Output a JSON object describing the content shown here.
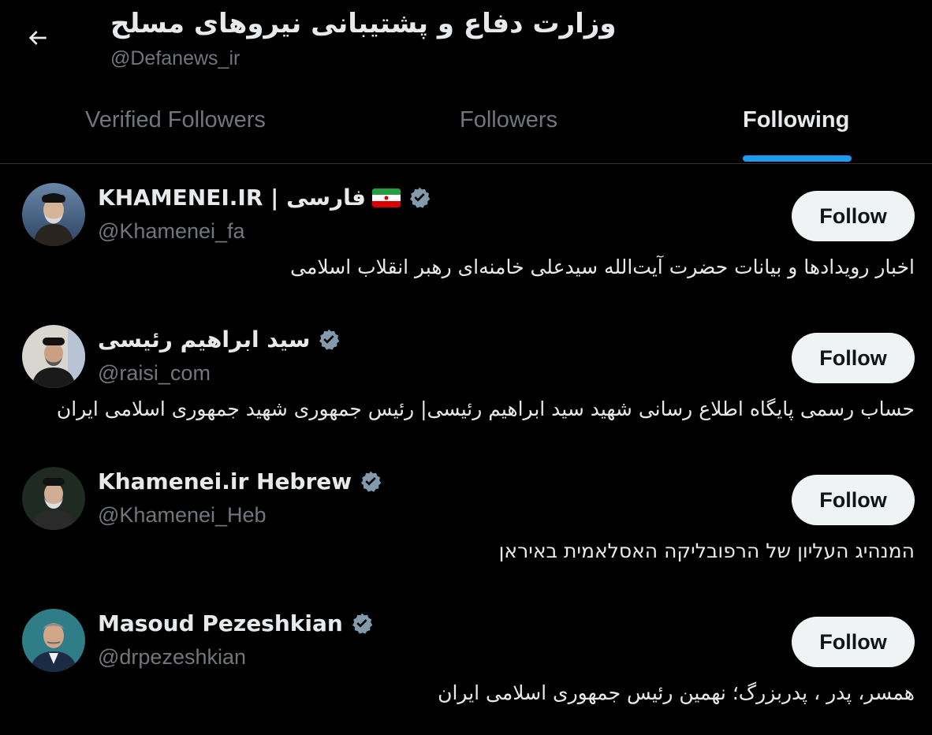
{
  "header": {
    "title": "وزارت دفاع و پشتیبانی نیروهای مسلح",
    "handle": "@Defanews_ir",
    "back_icon": "arrow-left-icon"
  },
  "tabs": [
    {
      "label": "Verified Followers",
      "active": false
    },
    {
      "label": "Followers",
      "active": false
    },
    {
      "label": "Following",
      "active": true
    }
  ],
  "accent_color": "#1d9bf0",
  "users": [
    {
      "name": "KHAMENEI.IR | فارسی",
      "has_flag": true,
      "flag_icon": "iran-flag-icon",
      "verified_icon": "verified-badge-icon",
      "handle": "@Khamenei_fa",
      "bio": "اخبار رویدادها و بیانات حضرت آیت‌الله سیدعلی خامنه‌ای رهبر انقلاب اسلامی",
      "button_label": "Follow"
    },
    {
      "name": "سید ابراهیم رئیسی",
      "has_flag": false,
      "verified_icon": "verified-badge-icon",
      "handle": "@raisi_com",
      "bio": "حساب رسمی پایگاه اطلاع رسانی شهید سید ابراهیم رئیسی| رئیس جمهوری شهید جمهوری اسلامی ایران",
      "button_label": "Follow"
    },
    {
      "name": "Khamenei.ir Hebrew",
      "has_flag": false,
      "verified_icon": "verified-badge-icon",
      "handle": "@Khamenei_Heb",
      "bio": "המנהיג העליון של הרפובליקה האסלאמית באיראן",
      "button_label": "Follow"
    },
    {
      "name": "Masoud Pezeshkian",
      "has_flag": false,
      "verified_icon": "verified-badge-icon",
      "handle": "@drpezeshkian",
      "bio": "همسر، پدر ، پدربزرگ؛ نهمین رئیس جمهوری اسلامی ایران",
      "button_label": "Follow"
    }
  ]
}
